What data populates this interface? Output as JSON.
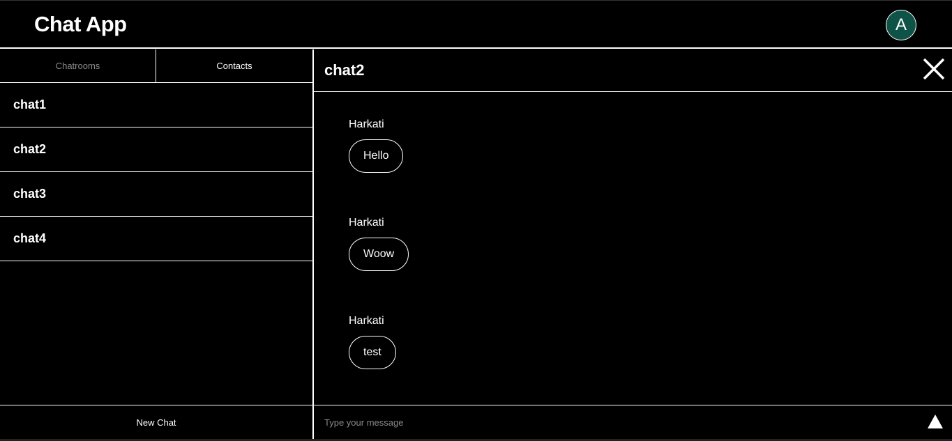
{
  "header": {
    "title": "Chat App",
    "avatar_initial": "A"
  },
  "sidebar": {
    "tabs": [
      {
        "label": "Chatrooms"
      },
      {
        "label": "Contacts"
      }
    ],
    "rooms": [
      {
        "name": "chat1"
      },
      {
        "name": "chat2"
      },
      {
        "name": "chat3"
      },
      {
        "name": "chat4"
      }
    ],
    "new_chat_label": "New Chat"
  },
  "chat": {
    "title": "chat2",
    "messages": [
      {
        "sender": "Harkati",
        "text": "Hello"
      },
      {
        "sender": "Harkati",
        "text": "Woow"
      },
      {
        "sender": "Harkati",
        "text": "test"
      }
    ],
    "input": {
      "placeholder": "Type your message",
      "value": ""
    }
  },
  "colors": {
    "background": "#000000",
    "avatar_bg": "#0e5248",
    "muted": "#8a8a8a"
  }
}
